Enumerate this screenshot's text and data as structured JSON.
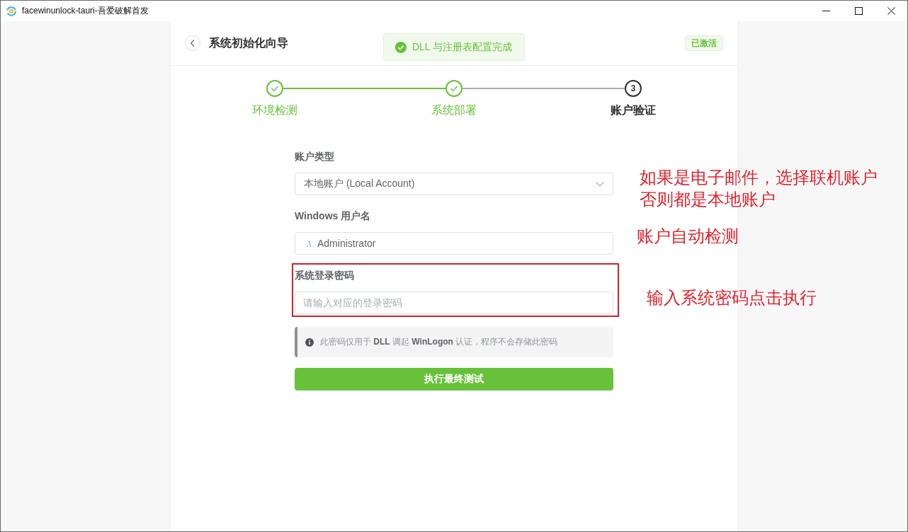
{
  "window": {
    "title": "facewinunlock-tauri-吾爱破解首发"
  },
  "header": {
    "title": "系统初始化向导",
    "status_tag": "已激活"
  },
  "toast": {
    "message": "DLL 与注册表配置完成"
  },
  "steps": [
    {
      "label": "环境检测",
      "completed": true,
      "selected": false
    },
    {
      "label": "系统部署",
      "completed": true,
      "selected": false
    },
    {
      "label": "账户验证",
      "completed": false,
      "selected": true,
      "number": "3"
    }
  ],
  "form": {
    "fields": [
      {
        "kind": "select",
        "label": "账户类型",
        "value": "本地账户 (Local Account)",
        "highlighted": false
      },
      {
        "kind": "text",
        "label": "Windows 用户名",
        "prefix": ".\\",
        "value": "Administrator",
        "highlighted": false
      },
      {
        "kind": "password",
        "label": "系统登录密码",
        "placeholder": "请输入对应的登录密码",
        "highlighted": true
      }
    ],
    "notice": "此密码仅用于 **DLL** 调起 **WinLogon** 认证，程序不会存储此密码",
    "submit": "执行最终测试"
  },
  "annotations": [
    {
      "lines": [
        "如果是电子邮件，选择联机账户",
        "否则都是本地账户"
      ]
    },
    {
      "lines": [
        "账户自动检测"
      ]
    },
    {
      "lines": [
        "输入系统密码点击执行"
      ]
    }
  ]
}
